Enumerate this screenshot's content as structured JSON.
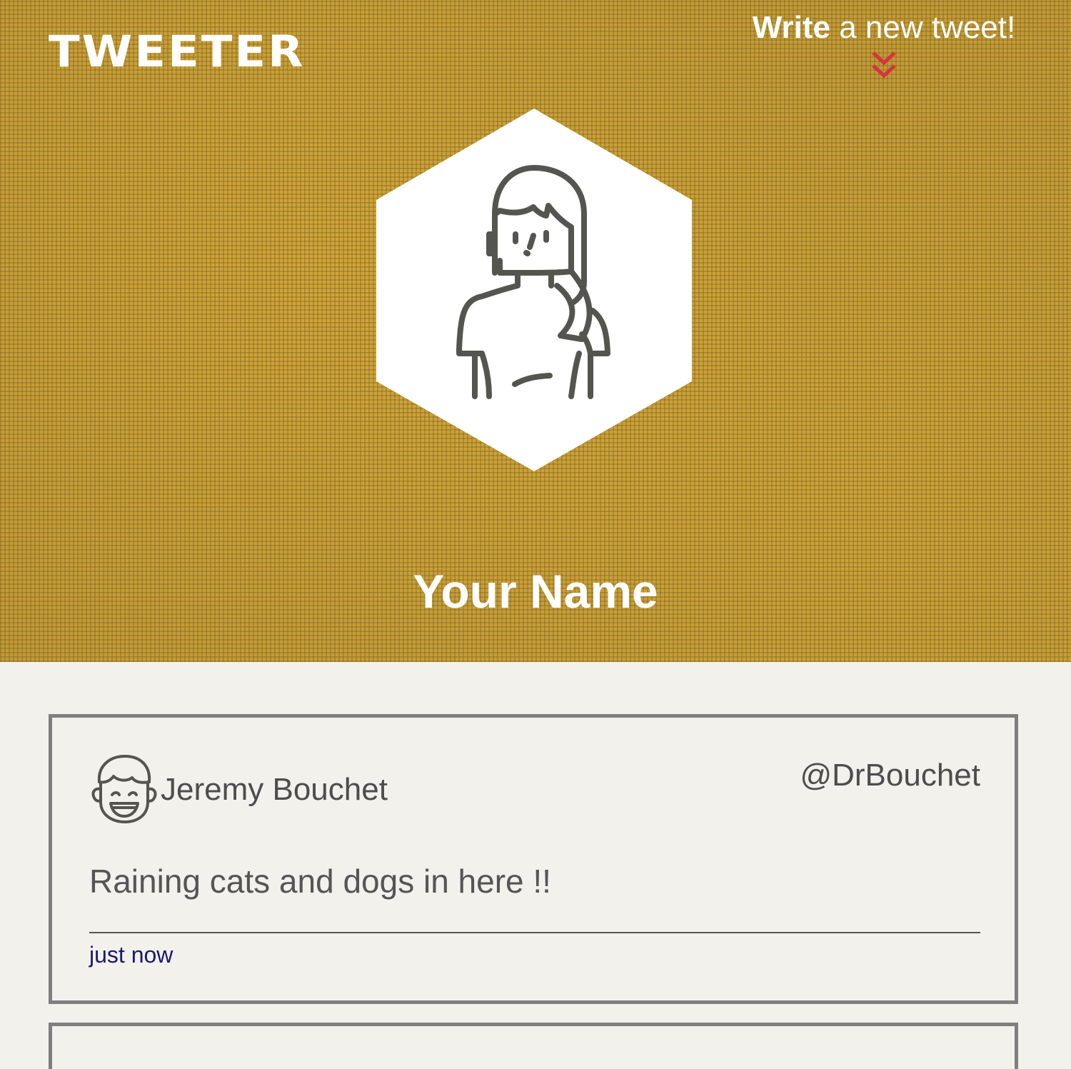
{
  "header": {
    "logo": "TWEETER",
    "compose": {
      "strong": "Write",
      "rest": " a new tweet!",
      "chevron_icon": "double-chevron-down-icon",
      "chevron_color": "#d7333f"
    },
    "profile": {
      "avatar_icon": "woman-avatar-icon",
      "name": "Your Name"
    },
    "background_color": "#c29a34"
  },
  "tweets": [
    {
      "avatar_icon": "smiling-man-avatar-icon",
      "name": "Jeremy Bouchet",
      "handle": "@DrBouchet",
      "text": "Raining cats and dogs in here !!",
      "time": "just now"
    }
  ]
}
